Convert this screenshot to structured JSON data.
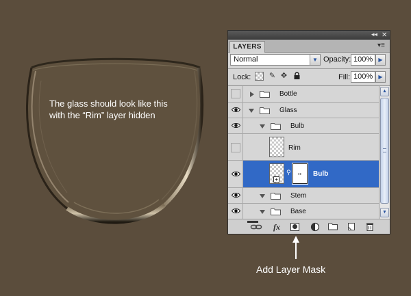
{
  "annotation": {
    "line1": "The glass should look like this",
    "line2": "with the “Rim” layer hidden"
  },
  "callout": {
    "label": "Add Layer Mask"
  },
  "panel": {
    "window_buttons": {
      "collapse": "◂◂",
      "close": "✕"
    },
    "tab_label": "LAYERS",
    "menu_icon": "panel-menu-icon",
    "blend_mode": "Normal",
    "opacity_label": "Opacity:",
    "opacity_value": "100%",
    "lock_label": "Lock:",
    "fill_label": "Fill:",
    "fill_value": "100%",
    "layers": [
      {
        "name": "Bottle",
        "type": "group",
        "visible": false,
        "expanded": false,
        "indent": 0
      },
      {
        "name": "Glass",
        "type": "group",
        "visible": true,
        "expanded": true,
        "indent": 0
      },
      {
        "name": "Bulb",
        "type": "group",
        "visible": true,
        "expanded": true,
        "indent": 1
      },
      {
        "name": "Rim",
        "type": "layer",
        "visible": false,
        "indent": 2
      },
      {
        "name": "Bulb",
        "type": "layer",
        "visible": true,
        "selected": true,
        "has_mask": true,
        "indent": 2
      },
      {
        "name": "Stem",
        "type": "group",
        "visible": true,
        "expanded": true,
        "indent": 1
      },
      {
        "name": "Base",
        "type": "group",
        "visible": true,
        "expanded": true,
        "indent": 1
      }
    ],
    "toolbar": {
      "link": "link-layers-icon",
      "fx": "fx",
      "mask": "add-layer-mask-icon",
      "adjust": "adjustment-layer-icon",
      "group": "new-group-icon",
      "new": "new-layer-icon",
      "delete": "trash-icon"
    }
  },
  "colors": {
    "background": "#5b4d3c",
    "selection": "#3169c6",
    "panel": "#d6d6d6"
  }
}
